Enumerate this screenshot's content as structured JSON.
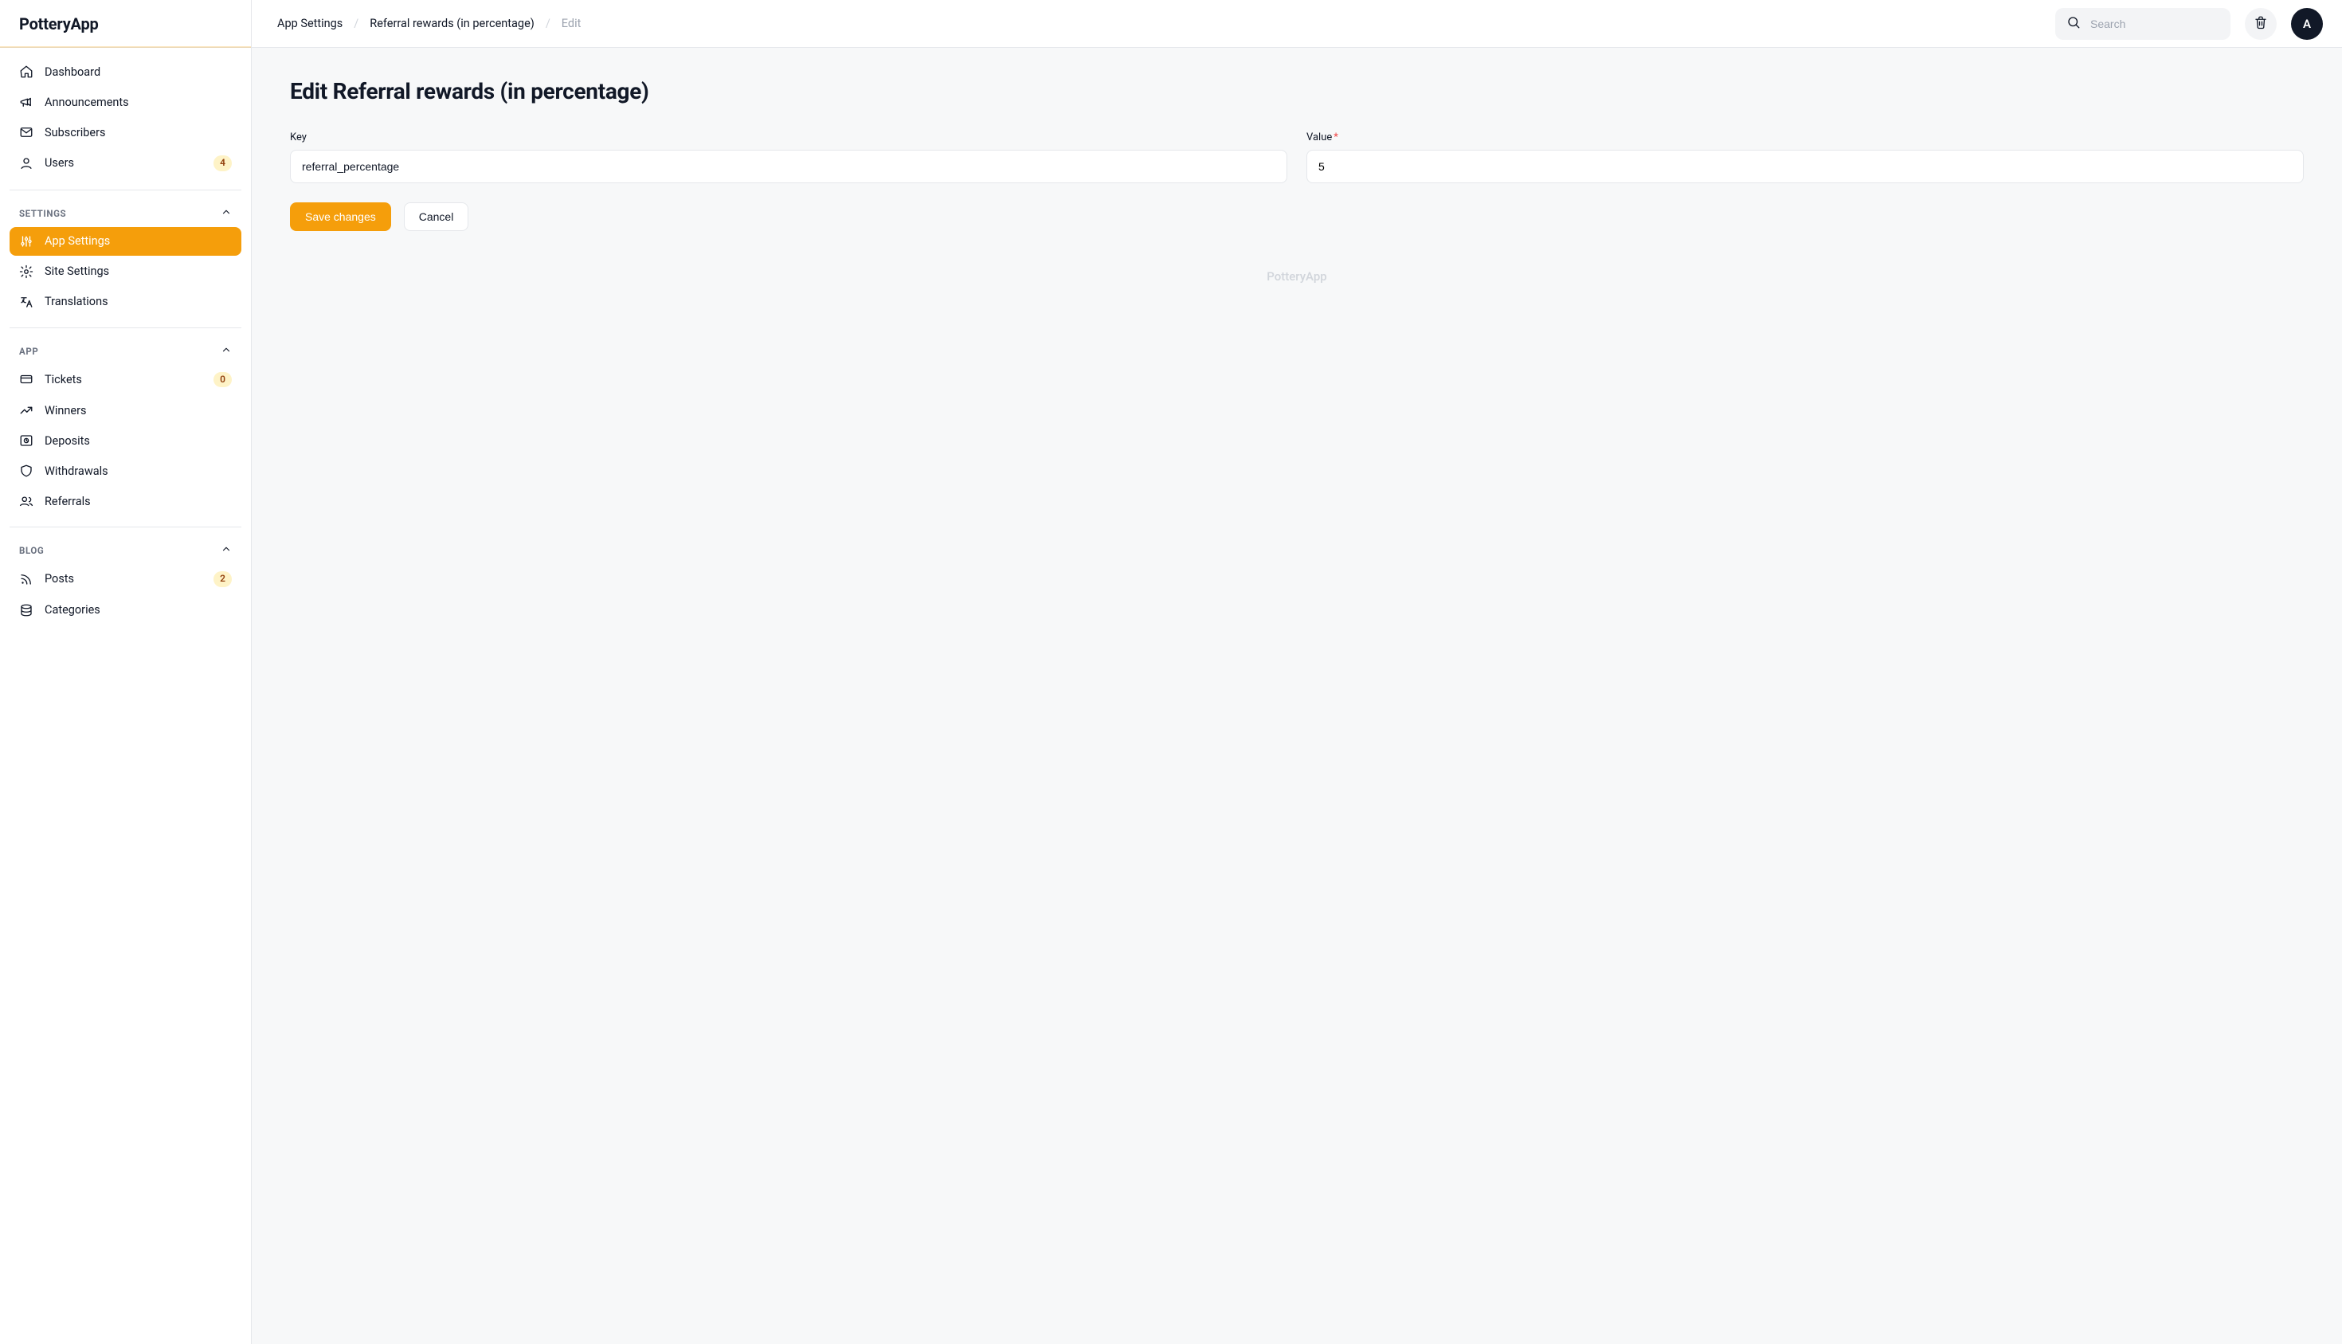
{
  "app_name": "PotteryApp",
  "topbar": {
    "breadcrumbs": [
      {
        "label": "App Settings"
      },
      {
        "label": "Referral rewards (in percentage)"
      },
      {
        "label": "Edit"
      }
    ],
    "search_placeholder": "Search",
    "avatar_initial": "A"
  },
  "sidebar": {
    "primary": [
      {
        "icon": "home-icon",
        "label": "Dashboard"
      },
      {
        "icon": "megaphone-icon",
        "label": "Announcements"
      },
      {
        "icon": "mail-icon",
        "label": "Subscribers"
      },
      {
        "icon": "user-icon",
        "label": "Users",
        "badge": "4"
      }
    ],
    "sections": [
      {
        "title": "SETTINGS",
        "items": [
          {
            "icon": "sliders-icon",
            "label": "App Settings",
            "active": true
          },
          {
            "icon": "gear-icon",
            "label": "Site Settings"
          },
          {
            "icon": "translate-icon",
            "label": "Translations"
          }
        ]
      },
      {
        "title": "APP",
        "items": [
          {
            "icon": "card-icon",
            "label": "Tickets",
            "badge": "0"
          },
          {
            "icon": "trend-icon",
            "label": "Winners"
          },
          {
            "icon": "vault-icon",
            "label": "Deposits"
          },
          {
            "icon": "shield-icon",
            "label": "Withdrawals"
          },
          {
            "icon": "users-icon",
            "label": "Referrals"
          }
        ]
      },
      {
        "title": "BLOG",
        "items": [
          {
            "icon": "rss-icon",
            "label": "Posts",
            "badge": "2"
          },
          {
            "icon": "db-icon",
            "label": "Categories"
          }
        ]
      }
    ]
  },
  "page": {
    "title": "Edit Referral rewards (in percentage)",
    "key_label": "Key",
    "key_value": "referral_percentage",
    "value_label": "Value",
    "value_required": true,
    "value_value": "5",
    "save_label": "Save changes",
    "cancel_label": "Cancel",
    "watermark": "PotteryApp"
  }
}
